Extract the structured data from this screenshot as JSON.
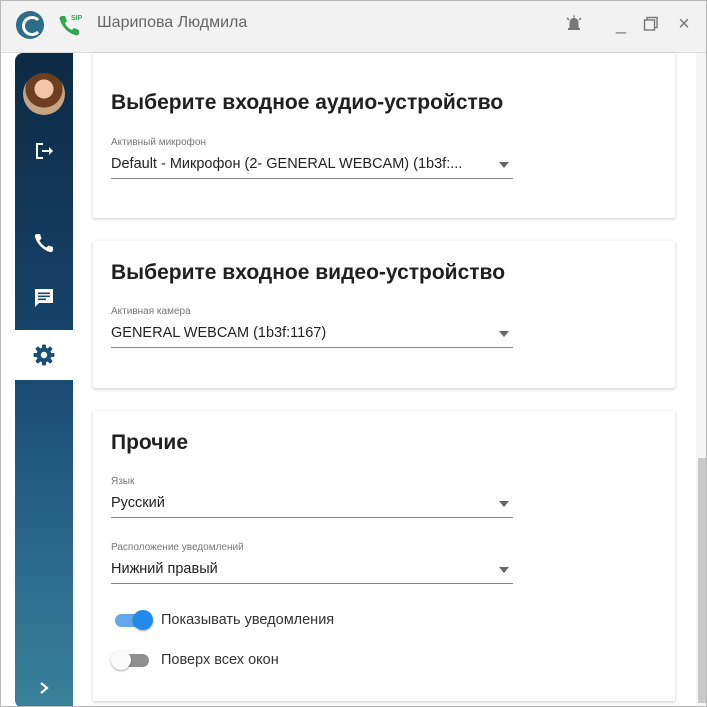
{
  "titlebar": {
    "title": "Шарипова Людмила",
    "sip_badge": "SIP",
    "buttons": {
      "alarm": "alarm-icon",
      "minimize": "_",
      "maximize": "maximize-icon",
      "close": "×"
    }
  },
  "sidebar": {
    "items": [
      "avatar",
      "logout-icon",
      "phone-icon",
      "chat-icon",
      "gear-icon",
      "chevron-right-icon"
    ],
    "active": "gear-icon"
  },
  "audio": {
    "title": "Выберите входное аудио-устройство",
    "label": "Активный микрофон",
    "value": "Default - Микрофон (2- GENERAL WEBCAM) (1b3f:..."
  },
  "video": {
    "title": "Выберите входное видео-устройство",
    "label": "Активная камера",
    "value": "GENERAL WEBCAM (1b3f:1167)"
  },
  "other": {
    "title": "Прочие",
    "language_label": "Язык",
    "language_value": "Русский",
    "position_label": "Расположение уведомлений",
    "position_value": "Нижний правый",
    "show_notifications_label": "Показывать уведомления",
    "show_notifications_on": true,
    "always_on_top_label": "Поверх всех окон",
    "always_on_top_on": false
  },
  "colors": {
    "accent": "#2189ea",
    "sidebar_top": "#0d2a44",
    "sidebar_bottom": "#3a8199",
    "sip_green": "#2fa84f"
  }
}
